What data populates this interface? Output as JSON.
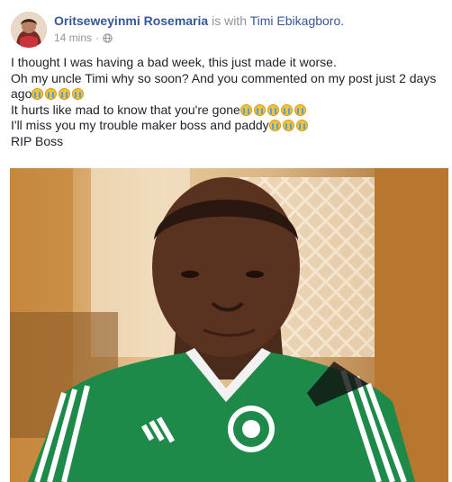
{
  "post": {
    "author": "Oritseweyinmi Rosemaria",
    "with_text": "is with",
    "tagged": "Timi Ebikagboro.",
    "time": "14 mins",
    "separator": "·",
    "privacy_icon": "globe-icon",
    "lines": [
      {
        "text": "I thought I was having a bad week, this just made it worse.",
        "emojis": 0
      },
      {
        "text": "Oh my uncle Timi why so soon? And you commented on my post just 2 days",
        "emojis": 0
      },
      {
        "text": "ago",
        "emojis": 4
      },
      {
        "text": "It hurts like mad to know that you're gone",
        "emojis": 5
      },
      {
        "text": "I'll miss you my trouble maker boss and paddy",
        "emojis": 3
      },
      {
        "text": "RIP Boss",
        "emojis": 0
      }
    ],
    "emoji_name": "loudly-crying-face"
  },
  "colors": {
    "author_link": "#365899",
    "meta_gray": "#90949c",
    "text": "#1d2129",
    "jersey_green": "#1d8a4a"
  }
}
